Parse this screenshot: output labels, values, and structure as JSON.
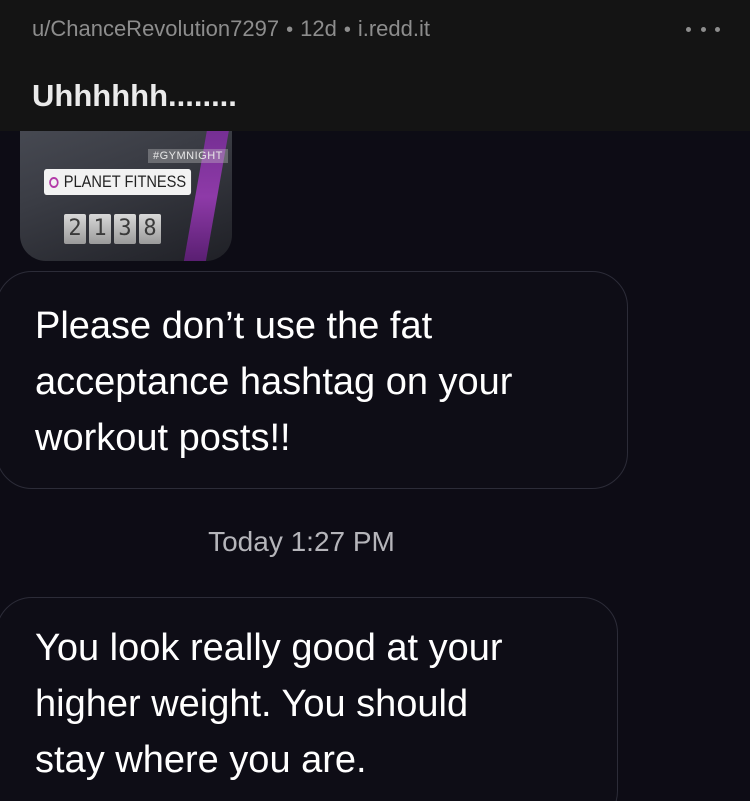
{
  "post": {
    "author": "u/ChanceRevolution7297",
    "separator": "•",
    "age": "12d",
    "domain": "i.redd.it",
    "title": "Uhhhhhh........",
    "more_icon": "ellipsis-icon"
  },
  "story": {
    "hashtag": "#GYMNIGHT",
    "location": "PLANET FITNESS",
    "location_icon": "pin-icon",
    "time_digits": [
      "2",
      "1",
      "3",
      "8"
    ]
  },
  "messages": [
    {
      "text": "Please don’t use the fat\nacceptance hashtag on your\nworkout posts!!"
    },
    {
      "text": "You look really good at your\nhigher weight. You should\nstay where you are."
    }
  ],
  "timestamp": "Today 1:27 PM",
  "colors": {
    "header_bg": "#141414",
    "chat_bg": "#0d0c15",
    "bubble_border": "#2c2c38",
    "meta_text": "#8d8d8d",
    "message_text": "#ffffff"
  }
}
